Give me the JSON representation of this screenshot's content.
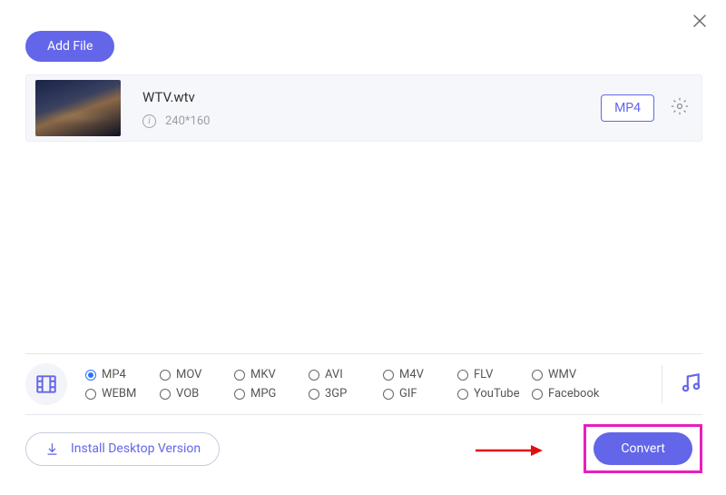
{
  "buttons": {
    "add_file": "Add File",
    "install": "Install Desktop Version",
    "convert": "Convert"
  },
  "file": {
    "name": "WTV.wtv",
    "resolution": "240*160",
    "output_format": "MP4"
  },
  "formats": {
    "selected": "MP4",
    "options": [
      "MP4",
      "MOV",
      "MKV",
      "AVI",
      "M4V",
      "FLV",
      "WMV",
      "WEBM",
      "VOB",
      "MPG",
      "3GP",
      "GIF",
      "YouTube",
      "Facebook"
    ]
  }
}
